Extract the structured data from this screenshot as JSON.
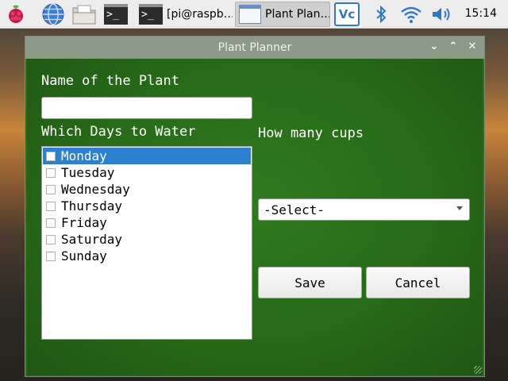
{
  "taskbar": {
    "terminal_label": "[pi@raspb…",
    "active_window_label": "Plant Plan…",
    "clock": "15:14"
  },
  "window": {
    "title": "Plant Planner"
  },
  "form": {
    "name_label": "Name of the Plant",
    "name_value": "",
    "days_label": "Which Days to Water",
    "cups_label": "How many cups",
    "days": [
      {
        "label": "Monday",
        "selected": true,
        "checked": false
      },
      {
        "label": "Tuesday",
        "selected": false,
        "checked": false
      },
      {
        "label": "Wednesday",
        "selected": false,
        "checked": false
      },
      {
        "label": "Thursday",
        "selected": false,
        "checked": false
      },
      {
        "label": "Friday",
        "selected": false,
        "checked": false
      },
      {
        "label": "Saturday",
        "selected": false,
        "checked": false
      },
      {
        "label": "Sunday",
        "selected": false,
        "checked": false
      }
    ],
    "cups_selected": "-Select-",
    "save_label": "Save",
    "cancel_label": "Cancel"
  },
  "colors": {
    "selection": "#2d7fd0",
    "client_background": "#276a18",
    "titlebar": "#8e9a89"
  }
}
